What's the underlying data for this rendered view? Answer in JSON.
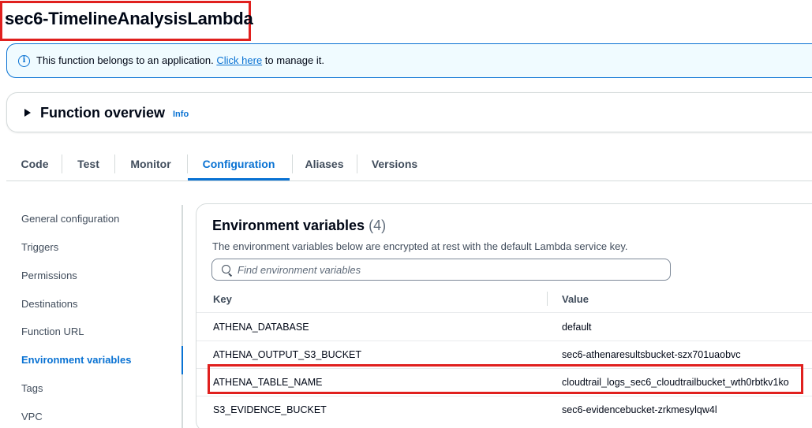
{
  "page": {
    "title": "sec6-TimelineAnalysisLambda"
  },
  "banner": {
    "icon": "info-icon",
    "text_before": "This function belongs to an application. ",
    "link_text": "Click here",
    "text_after": " to manage it."
  },
  "overview": {
    "title": "Function overview",
    "info_link": "Info"
  },
  "tabs": [
    {
      "label": "Code"
    },
    {
      "label": "Test"
    },
    {
      "label": "Monitor"
    },
    {
      "label": "Configuration",
      "active": true
    },
    {
      "label": "Aliases"
    },
    {
      "label": "Versions"
    }
  ],
  "sidebar": {
    "items": [
      {
        "label": "General configuration"
      },
      {
        "label": "Triggers"
      },
      {
        "label": "Permissions"
      },
      {
        "label": "Destinations"
      },
      {
        "label": "Function URL"
      },
      {
        "label": "Environment variables",
        "active": true
      },
      {
        "label": "Tags"
      },
      {
        "label": "VPC"
      }
    ]
  },
  "env": {
    "title": "Environment variables",
    "count": "(4)",
    "description": "The environment variables below are encrypted at rest with the default Lambda service key.",
    "search_placeholder": "Find environment variables",
    "columns": {
      "key": "Key",
      "value": "Value"
    },
    "rows": [
      {
        "key": "ATHENA_DATABASE",
        "value": "default"
      },
      {
        "key": "ATHENA_OUTPUT_S3_BUCKET",
        "value": "sec6-athenaresultsbucket-szx701uaobvc"
      },
      {
        "key": "ATHENA_TABLE_NAME",
        "value": "cloudtrail_logs_sec6_cloudtrailbucket_wth0rbtkv1ko",
        "highlighted": true
      },
      {
        "key": "S3_EVIDENCE_BUCKET",
        "value": "sec6-evidencebucket-zrkmesylqw4l"
      }
    ]
  },
  "colors": {
    "accent": "#0972d3",
    "highlight_box": "#e0201e",
    "banner_bg": "#f0fbff"
  }
}
